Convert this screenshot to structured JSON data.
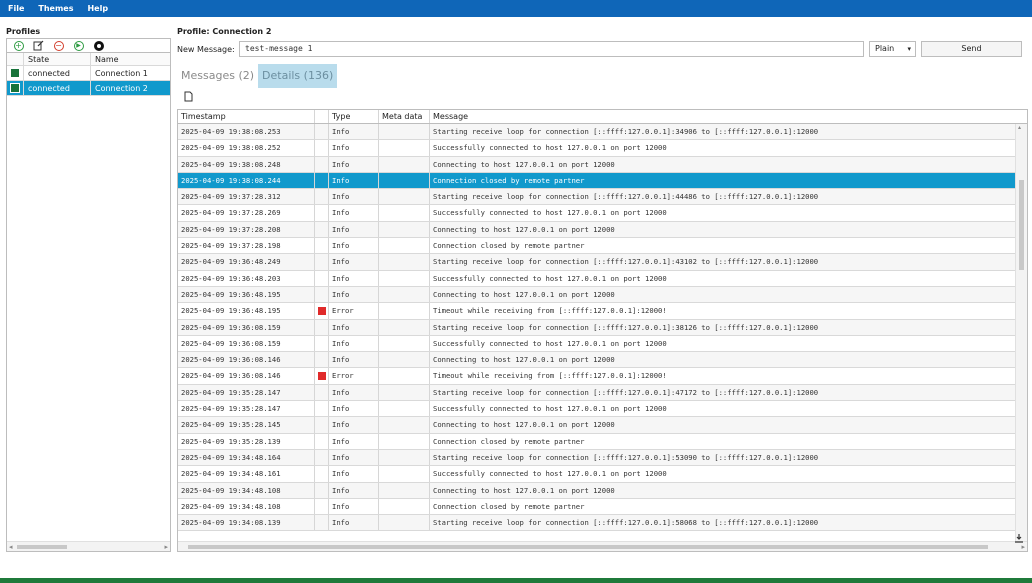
{
  "menu": [
    "File",
    "Themes",
    "Help"
  ],
  "profiles": {
    "title": "Profiles",
    "toolbar_icons": [
      "add-icon",
      "edit-icon",
      "remove-icon",
      "connect-icon",
      "settings-icon"
    ],
    "columns": [
      "State",
      "Name"
    ],
    "rows": [
      {
        "state": "connected",
        "name": "Connection 1",
        "selected": false
      },
      {
        "state": "connected",
        "name": "Connection 2",
        "selected": true
      }
    ]
  },
  "main": {
    "title": "Profile: Connection 2",
    "new_message_label": "New Message:",
    "message_value": "test-message 1",
    "format_value": "Plain",
    "send_label": "Send",
    "tabs": [
      {
        "label": "Messages (2)",
        "active": false
      },
      {
        "label": "Details (136)",
        "active": true
      }
    ],
    "columns": [
      "Timestamp",
      "",
      "Type",
      "Meta data",
      "Message"
    ],
    "rows": [
      {
        "ts": "2025-04-09 19:38:08.253",
        "type": "Info",
        "meta": "",
        "msg": "Starting receive loop for connection [::ffff:127.0.0.1]:34906 to [::ffff:127.0.0.1]:12000"
      },
      {
        "ts": "2025-04-09 19:38:08.252",
        "type": "Info",
        "meta": "",
        "msg": "Successfully connected to host 127.0.0.1 on port 12000"
      },
      {
        "ts": "2025-04-09 19:38:08.248",
        "type": "Info",
        "meta": "",
        "msg": "Connecting to host 127.0.0.1 on port 12000"
      },
      {
        "ts": "2025-04-09 19:38:08.244",
        "type": "Info",
        "meta": "",
        "msg": "Connection closed by remote partner",
        "selected": true
      },
      {
        "ts": "2025-04-09 19:37:28.312",
        "type": "Info",
        "meta": "",
        "msg": "Starting receive loop for connection [::ffff:127.0.0.1]:44486 to [::ffff:127.0.0.1]:12000"
      },
      {
        "ts": "2025-04-09 19:37:28.269",
        "type": "Info",
        "meta": "",
        "msg": "Successfully connected to host 127.0.0.1 on port 12000"
      },
      {
        "ts": "2025-04-09 19:37:28.208",
        "type": "Info",
        "meta": "",
        "msg": "Connecting to host 127.0.0.1 on port 12000"
      },
      {
        "ts": "2025-04-09 19:37:28.198",
        "type": "Info",
        "meta": "",
        "msg": "Connection closed by remote partner"
      },
      {
        "ts": "2025-04-09 19:36:48.249",
        "type": "Info",
        "meta": "",
        "msg": "Starting receive loop for connection [::ffff:127.0.0.1]:43102 to [::ffff:127.0.0.1]:12000"
      },
      {
        "ts": "2025-04-09 19:36:48.203",
        "type": "Info",
        "meta": "",
        "msg": "Successfully connected to host 127.0.0.1 on port 12000"
      },
      {
        "ts": "2025-04-09 19:36:48.195",
        "type": "Info",
        "meta": "",
        "msg": "Connecting to host 127.0.0.1 on port 12000"
      },
      {
        "ts": "2025-04-09 19:36:48.195",
        "type": "Error",
        "meta": "",
        "msg": "Timeout while receiving from [::ffff:127.0.0.1]:12000!",
        "error": true
      },
      {
        "ts": "2025-04-09 19:36:08.159",
        "type": "Info",
        "meta": "",
        "msg": "Starting receive loop for connection [::ffff:127.0.0.1]:38126 to [::ffff:127.0.0.1]:12000"
      },
      {
        "ts": "2025-04-09 19:36:08.159",
        "type": "Info",
        "meta": "",
        "msg": "Successfully connected to host 127.0.0.1 on port 12000"
      },
      {
        "ts": "2025-04-09 19:36:08.146",
        "type": "Info",
        "meta": "",
        "msg": "Connecting to host 127.0.0.1 on port 12000"
      },
      {
        "ts": "2025-04-09 19:36:08.146",
        "type": "Error",
        "meta": "",
        "msg": "Timeout while receiving from [::ffff:127.0.0.1]:12000!",
        "error": true
      },
      {
        "ts": "2025-04-09 19:35:28.147",
        "type": "Info",
        "meta": "",
        "msg": "Starting receive loop for connection [::ffff:127.0.0.1]:47172 to [::ffff:127.0.0.1]:12000"
      },
      {
        "ts": "2025-04-09 19:35:28.147",
        "type": "Info",
        "meta": "",
        "msg": "Successfully connected to host 127.0.0.1 on port 12000"
      },
      {
        "ts": "2025-04-09 19:35:28.145",
        "type": "Info",
        "meta": "",
        "msg": "Connecting to host 127.0.0.1 on port 12000"
      },
      {
        "ts": "2025-04-09 19:35:28.139",
        "type": "Info",
        "meta": "",
        "msg": "Connection closed by remote partner"
      },
      {
        "ts": "2025-04-09 19:34:48.164",
        "type": "Info",
        "meta": "",
        "msg": "Starting receive loop for connection [::ffff:127.0.0.1]:53090 to [::ffff:127.0.0.1]:12000"
      },
      {
        "ts": "2025-04-09 19:34:48.161",
        "type": "Info",
        "meta": "",
        "msg": "Successfully connected to host 127.0.0.1 on port 12000"
      },
      {
        "ts": "2025-04-09 19:34:48.108",
        "type": "Info",
        "meta": "",
        "msg": "Connecting to host 127.0.0.1 on port 12000"
      },
      {
        "ts": "2025-04-09 19:34:48.108",
        "type": "Info",
        "meta": "",
        "msg": "Connection closed by remote partner"
      },
      {
        "ts": "2025-04-09 19:34:08.139",
        "type": "Info",
        "meta": "",
        "msg": "Starting receive loop for connection [::ffff:127.0.0.1]:58068 to [::ffff:127.0.0.1]:12000"
      }
    ]
  },
  "colors": {
    "menubar": "#0f66b8",
    "selection": "#1199cc",
    "connected": "#18733a",
    "error": "#e02a2a",
    "statusbar": "#1f7a3a"
  }
}
